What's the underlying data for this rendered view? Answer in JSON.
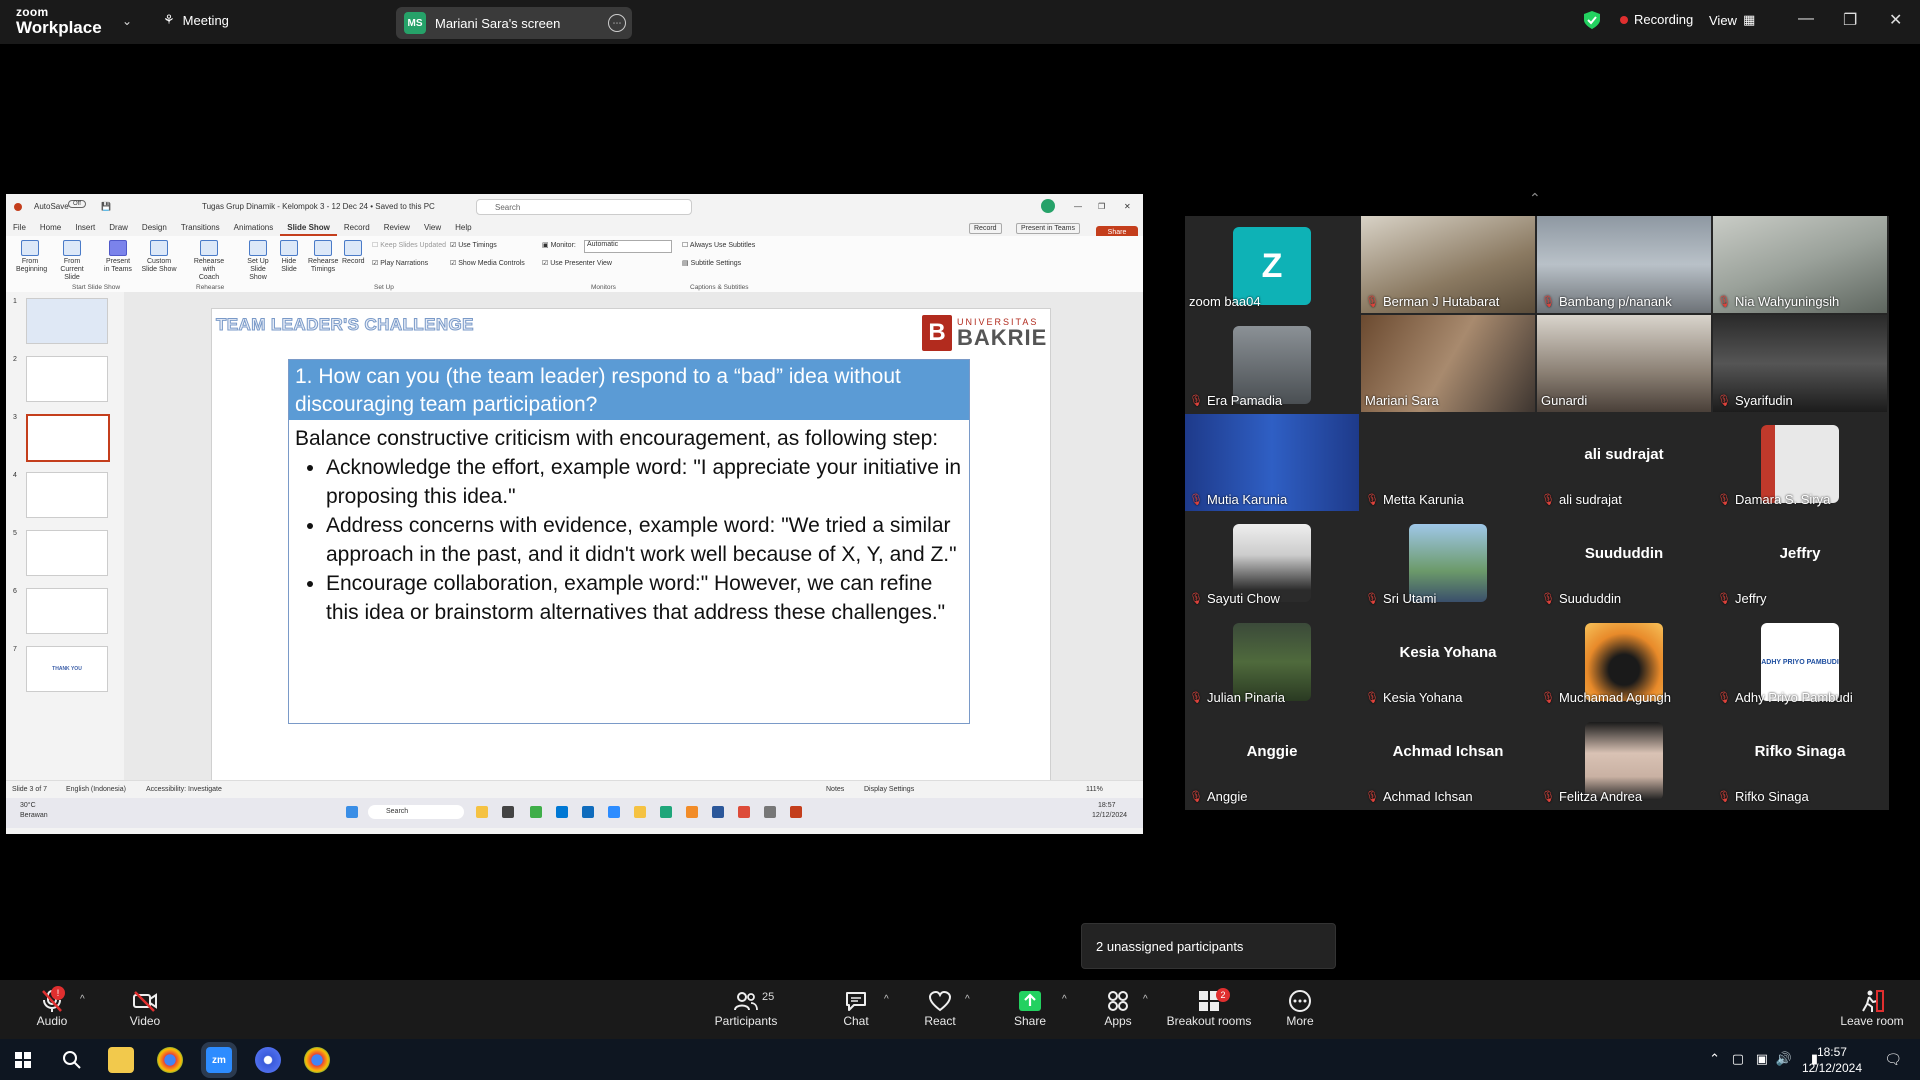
{
  "topbar": {
    "brand_line1": "zoom",
    "brand_line2": "Workplace",
    "meeting_label": "Meeting",
    "share_initials": "MS",
    "share_label": "Mariani Sara's screen",
    "recording_label": "Recording",
    "view_label": "View"
  },
  "ppt": {
    "autosave": "AutoSave",
    "autosave_state": "Off",
    "doc_title": "Tugas Grup Dinamik - Kelompok 3 - 12 Dec 24 • Saved to this PC",
    "search_placeholder": "Search",
    "menu": [
      "File",
      "Home",
      "Insert",
      "Draw",
      "Design",
      "Transitions",
      "Animations",
      "Slide Show",
      "Record",
      "Review",
      "View",
      "Help"
    ],
    "record_btn": "Record",
    "present_teams": "Present in Teams",
    "share_btn": "Share",
    "ribbon": {
      "from_beginning": "From Beginning",
      "from_current": "From Current Slide",
      "present_teams": "Present in Teams",
      "custom_show": "Custom Slide Show",
      "rehearse_coach": "Rehearse with Coach",
      "setup_show": "Set Up Slide Show",
      "hide_slide": "Hide Slide",
      "rehearse_timings": "Rehearse Timings",
      "record": "Record",
      "keep_updated": "Keep Slides Updated",
      "play_narrations": "Play Narrations",
      "use_timings": "Use Timings",
      "show_media": "Show Media Controls",
      "monitor_label": "Monitor:",
      "monitor_value": "Automatic",
      "presenter_view": "Use Presenter View",
      "always_subtitles": "Always Use Subtitles",
      "subtitle_settings": "Subtitle Settings",
      "grp_start": "Start Slide Show",
      "grp_rehearse": "Rehearse",
      "grp_setup": "Set Up",
      "grp_monitors": "Monitors",
      "grp_captions": "Captions & Subtitles"
    },
    "thumb_numbers": [
      "1",
      "2",
      "3",
      "4",
      "5",
      "6",
      "7"
    ],
    "thumb7_text": "THANK YOU",
    "slide": {
      "title": "TEAM LEADER'S CHALLENGE",
      "univ_small": "UNIVERSITAS",
      "univ_big": "BAKRIE",
      "question": "1. How can you (the team leader) respond to a “bad” idea without discouraging team participation?",
      "intro": "Balance constructive criticism with encouragement, as following step:",
      "bullets": [
        "Acknowledge the effort, example word: \"I appreciate your initiative in proposing this idea.\"",
        "Address concerns with evidence, example word: \"We tried a similar approach in the past, and it didn't work well because of X, Y, and Z.\"",
        "Encourage collaboration, example word:\" However, we can refine this idea or brainstorm alternatives that address these challenges.\""
      ]
    },
    "status": {
      "slide_of": "Slide 3 of 7",
      "language": "English (Indonesia)",
      "accessibility": "Accessibility: Investigate",
      "notes": "Notes",
      "display_settings": "Display Settings",
      "zoom": "111%"
    },
    "taskbar": {
      "temp": "30°C",
      "weather": "Berawan",
      "search": "Search",
      "time": "18:57",
      "date": "12/12/2024"
    }
  },
  "gallery": {
    "tiles": [
      {
        "name": "zoom baa04",
        "initial": "Z"
      },
      {
        "name": "Berman J Hutabarat"
      },
      {
        "name": "Bambang p/nanank"
      },
      {
        "name": "Nia Wahyuningsih"
      },
      {
        "name": "Era Pamadia"
      },
      {
        "name": "Mariani Sara"
      },
      {
        "name": "Gunardi"
      },
      {
        "name": "Syarifudin"
      },
      {
        "name": "Mutia Karunia"
      },
      {
        "name": "Metta Karunia"
      },
      {
        "name": "ali sudrajat",
        "big": "ali sudrajat"
      },
      {
        "name": "Damara S. Sirya"
      },
      {
        "name": "Sayuti Chow"
      },
      {
        "name": "Sri Utami"
      },
      {
        "name": "Suududdin",
        "big": "Suududdin"
      },
      {
        "name": "Jeffry",
        "big": "Jeffry"
      },
      {
        "name": "Julian Pinaria"
      },
      {
        "name": "Kesia Yohana",
        "big": "Kesia Yohana"
      },
      {
        "name": "Muchamad Agungh"
      },
      {
        "name": "Adhy Priyo Pambudi",
        "logo": "ADHY PRIYO PAMBUDI"
      },
      {
        "name": "Anggie",
        "big": "Anggie"
      },
      {
        "name": "Achmad Ichsan",
        "big": "Achmad Ichsan"
      },
      {
        "name": "Felitza Andrea"
      },
      {
        "name": "Rifko Sinaga",
        "big": "Rifko Sinaga"
      }
    ]
  },
  "popup": {
    "unassigned": "2 unassigned participants"
  },
  "toolbar": {
    "audio": "Audio",
    "video": "Video",
    "participants": "Participants",
    "participants_count": "25",
    "chat": "Chat",
    "react": "React",
    "share": "Share",
    "apps": "Apps",
    "breakout": "Breakout rooms",
    "breakout_badge": "2",
    "more": "More",
    "leave": "Leave room"
  },
  "windows": {
    "time": "18:57",
    "date": "12/12/2024"
  }
}
